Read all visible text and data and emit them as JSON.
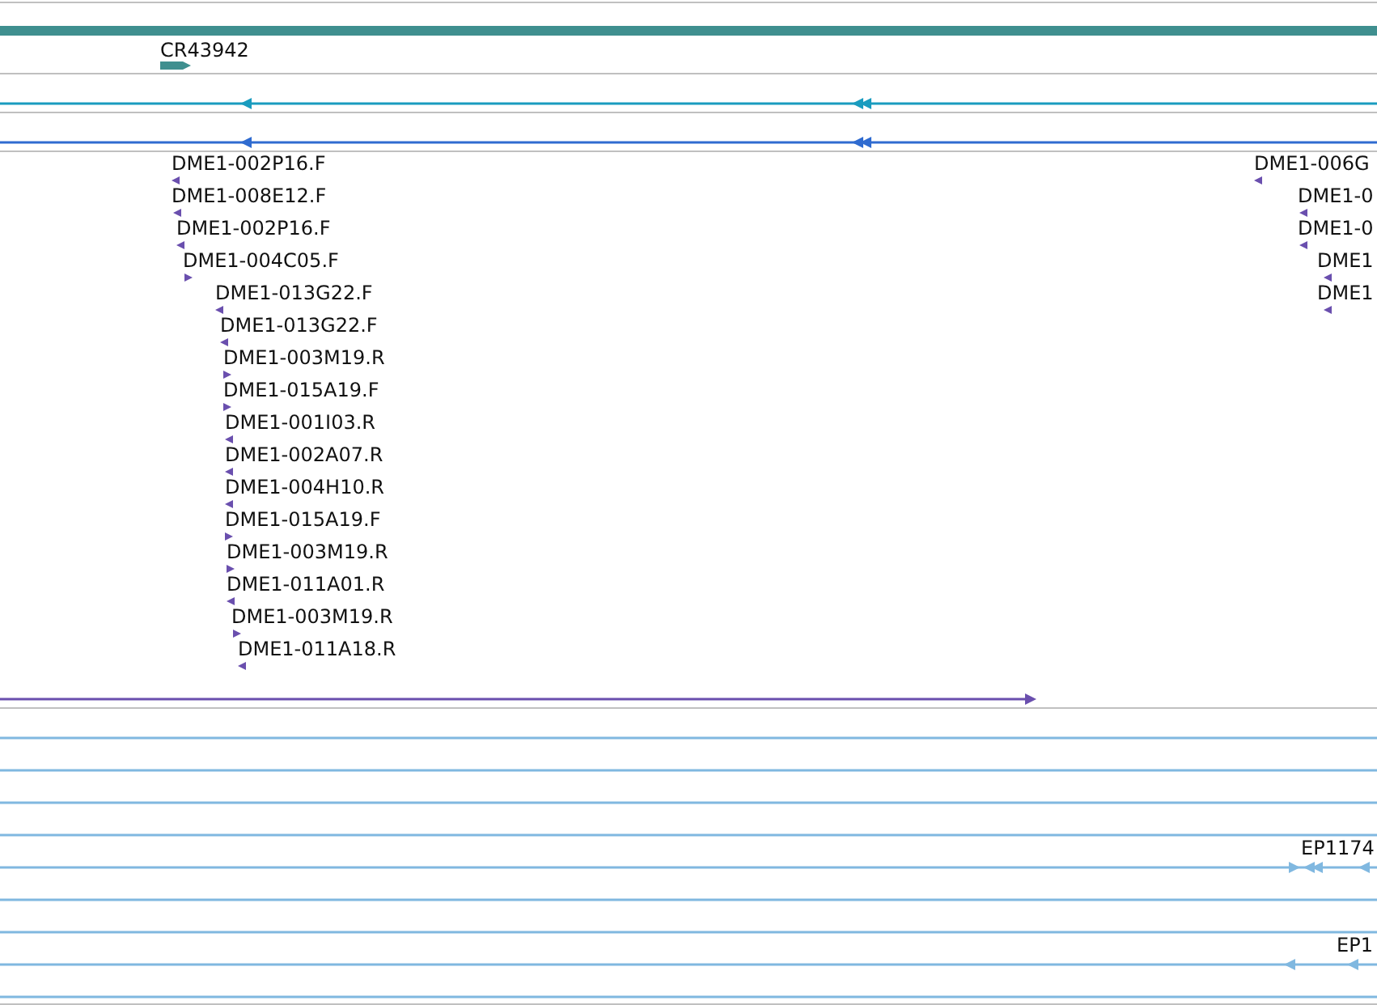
{
  "tracks": [
    {
      "features": [
        {
          "kind": "bar"
        },
        {
          "kind": "block",
          "label": "CR43942",
          "reverse": false
        }
      ]
    },
    {
      "features": [
        {
          "kind": "line",
          "marks": [
            {
              "reverse": true
            },
            {
              "reverse": true
            },
            {
              "reverse": true
            }
          ]
        }
      ]
    },
    {
      "features": [
        {
          "kind": "line",
          "marks": [
            {
              "reverse": true
            },
            {
              "reverse": true
            },
            {
              "reverse": true
            }
          ]
        }
      ]
    },
    {
      "features": [
        {
          "kind": "tick",
          "label": "DME1-002P16.F",
          "reverse": true
        },
        {
          "kind": "tick",
          "label": "DME1-008E12.F",
          "reverse": true
        },
        {
          "kind": "tick",
          "label": "DME1-002P16.F",
          "reverse": true
        },
        {
          "kind": "tick",
          "label": "DME1-004C05.F",
          "reverse": false
        },
        {
          "kind": "tick",
          "label": "DME1-013G22.F",
          "reverse": true
        },
        {
          "kind": "tick",
          "label": "DME1-013G22.F",
          "reverse": true
        },
        {
          "kind": "tick",
          "label": "DME1-003M19.R",
          "reverse": false
        },
        {
          "kind": "tick",
          "label": "DME1-015A19.F",
          "reverse": false
        },
        {
          "kind": "tick",
          "label": "DME1-001I03.R",
          "reverse": true
        },
        {
          "kind": "tick",
          "label": "DME1-002A07.R",
          "reverse": true
        },
        {
          "kind": "tick",
          "label": "DME1-004H10.R",
          "reverse": true
        },
        {
          "kind": "tick",
          "label": "DME1-015A19.F",
          "reverse": false
        },
        {
          "kind": "tick",
          "label": "DME1-003M19.R",
          "reverse": false
        },
        {
          "kind": "tick",
          "label": "DME1-011A01.R",
          "reverse": true
        },
        {
          "kind": "tick",
          "label": "DME1-003M19.R",
          "reverse": false
        },
        {
          "kind": "tick",
          "label": "DME1-011A18.R",
          "reverse": true
        },
        {
          "kind": "tick",
          "label": "DME1-006G",
          "reverse": true
        },
        {
          "kind": "tick",
          "label": "DME1-0",
          "reverse": true
        },
        {
          "kind": "tick",
          "label": "DME1-0",
          "reverse": true
        },
        {
          "kind": "tick",
          "label": "DME1",
          "reverse": true
        },
        {
          "kind": "tick",
          "label": "DME1",
          "reverse": true
        },
        {
          "kind": "line",
          "marks": [
            {
              "reverse": false
            }
          ]
        }
      ]
    },
    {
      "features": [
        {
          "kind": "line"
        },
        {
          "kind": "line"
        },
        {
          "kind": "line"
        },
        {
          "kind": "line"
        },
        {
          "kind": "line",
          "label": "EP1174",
          "marks": [
            {
              "reverse": false
            },
            {
              "reverse": true
            },
            {
              "reverse": true
            },
            {
              "reverse": true
            }
          ]
        },
        {
          "kind": "line"
        },
        {
          "kind": "line"
        },
        {
          "kind": "line",
          "label": "EP1",
          "marks": [
            {
              "reverse": true
            },
            {
              "reverse": true
            }
          ]
        },
        {
          "kind": "line"
        }
      ]
    }
  ]
}
